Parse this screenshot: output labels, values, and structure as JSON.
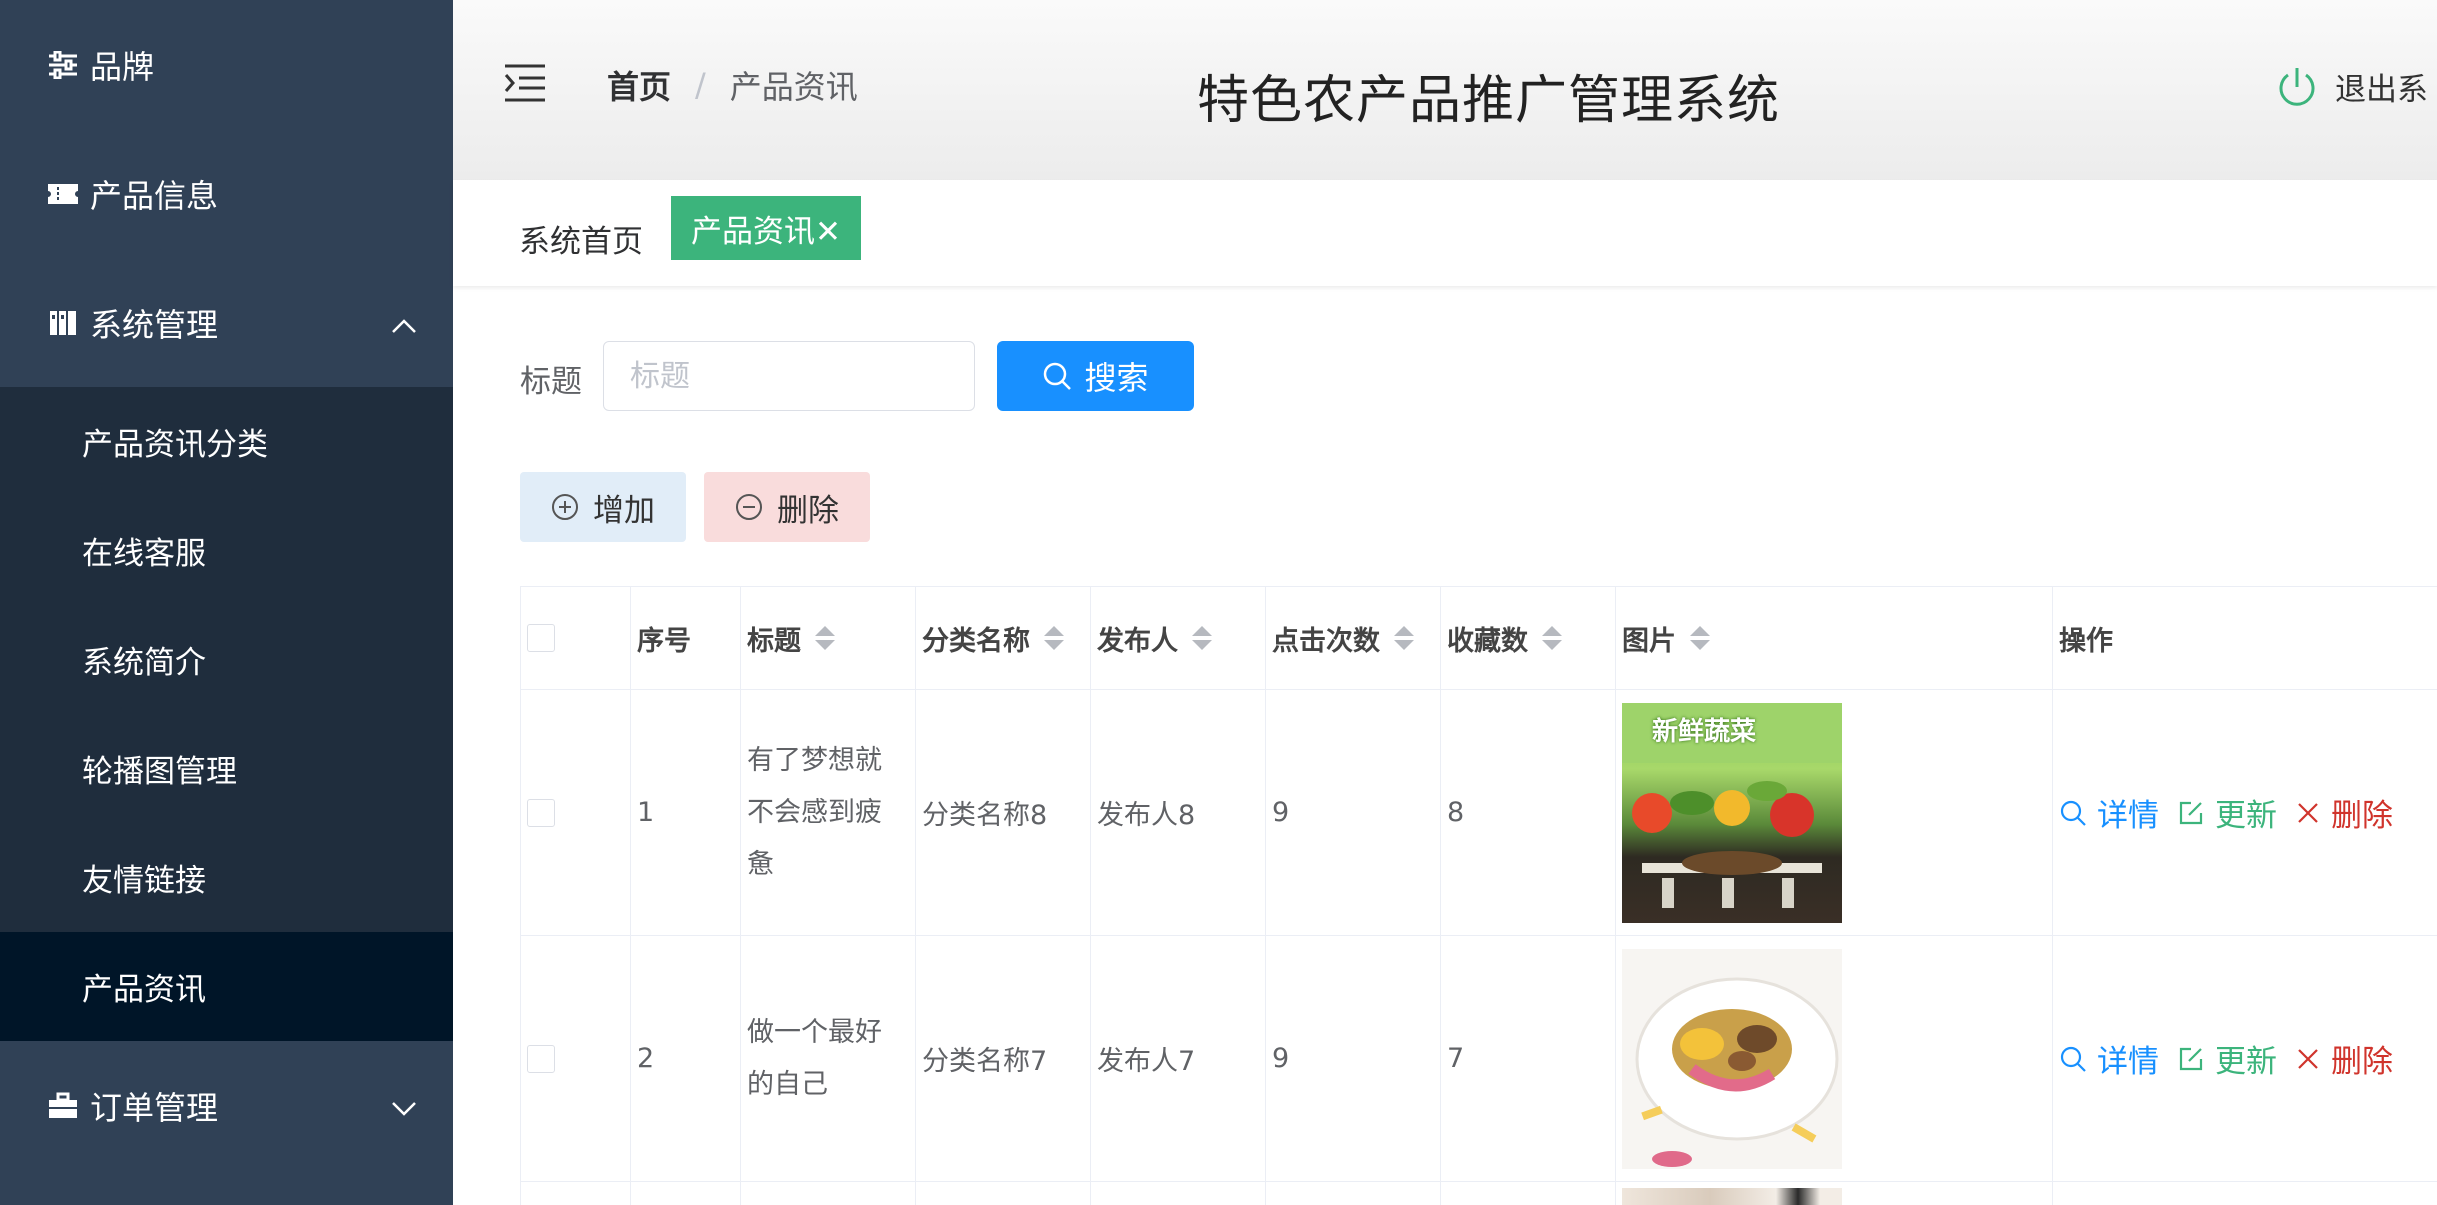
{
  "sidebar": {
    "items": [
      {
        "label": "品牌",
        "icon": "sliders-icon"
      },
      {
        "label": "产品信息",
        "icon": "ticket-icon"
      },
      {
        "label": "系统管理",
        "icon": "book-icon"
      }
    ],
    "submenu": [
      {
        "label": "产品资讯分类"
      },
      {
        "label": "在线客服"
      },
      {
        "label": "系统简介"
      },
      {
        "label": "轮播图管理"
      },
      {
        "label": "友情链接"
      },
      {
        "label": "产品资讯"
      }
    ],
    "order": {
      "label": "订单管理",
      "icon": "briefcase-icon"
    }
  },
  "header": {
    "breadcrumb": {
      "home": "首页",
      "current": "产品资讯"
    },
    "title": "特色农产品推广管理系统",
    "logout": "退出系"
  },
  "tags": {
    "home": "系统首页",
    "active": "产品资讯✕"
  },
  "search": {
    "label": "标题",
    "placeholder": "标题",
    "button": "搜索"
  },
  "actions": {
    "add": "增加",
    "delete": "删除"
  },
  "table": {
    "columns": [
      "序号",
      "标题",
      "分类名称",
      "发布人",
      "点击次数",
      "收藏数",
      "图片",
      "操作"
    ],
    "rows": [
      {
        "index": "1",
        "title": "有了梦想就不会感到疲惫",
        "category": "分类名称8",
        "publisher": "发布人8",
        "clicks": "9",
        "favorites": "8",
        "image_text": "新鲜蔬菜"
      },
      {
        "index": "2",
        "title": "做一个最好的自己",
        "category": "分类名称7",
        "publisher": "发布人7",
        "clicks": "9",
        "favorites": "7",
        "image_text": ""
      }
    ],
    "ops": {
      "detail": "详情",
      "update": "更新",
      "remove": "删除"
    }
  },
  "colors": {
    "sidebar": "#304156",
    "submenu": "#1f2d3d",
    "active": "#001528",
    "accent_green": "#3cb47c",
    "primary": "#1890ff",
    "danger": "#d0342c"
  }
}
